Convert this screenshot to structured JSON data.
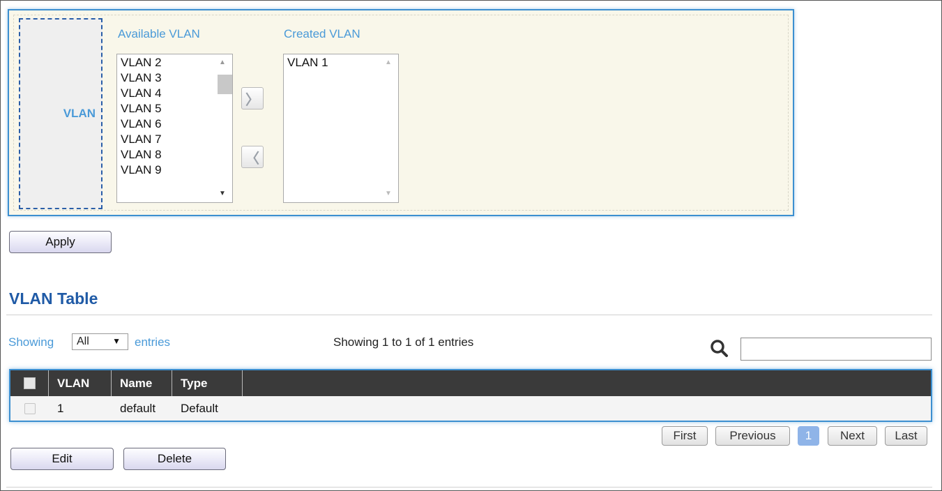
{
  "vlan_selector": {
    "label": "VLAN",
    "available_title": "Available VLAN",
    "created_title": "Created VLAN",
    "available_items": [
      "VLAN 2",
      "VLAN 3",
      "VLAN 4",
      "VLAN 5",
      "VLAN 6",
      "VLAN 7",
      "VLAN 8",
      "VLAN 9"
    ],
    "created_items": [
      "VLAN 1"
    ],
    "add_button_icon": "chevron-right-icon",
    "add_button_glyph": "〉",
    "remove_button_icon": "chevron-left-icon",
    "remove_button_glyph": "〈"
  },
  "apply_label": "Apply",
  "table_section": {
    "title": "VLAN Table",
    "showing_label": "Showing",
    "entries_label": "entries",
    "entries_select_value": "All",
    "info": "Showing 1 to 1 of 1 entries",
    "columns": [
      "VLAN",
      "Name",
      "Type"
    ],
    "rows": [
      {
        "vlan": "1",
        "name": "default",
        "type": "Default"
      }
    ]
  },
  "pagination": {
    "first": "First",
    "previous": "Previous",
    "current": "1",
    "next": "Next",
    "last": "Last"
  },
  "actions": {
    "edit": "Edit",
    "delete": "Delete"
  },
  "colors": {
    "accent_blue": "#4a9ad8",
    "title_blue": "#1f5aa6",
    "panel_bg": "#f9f7ea",
    "header_bg": "#3a3a3a",
    "active_page": "#8fb4e8"
  }
}
